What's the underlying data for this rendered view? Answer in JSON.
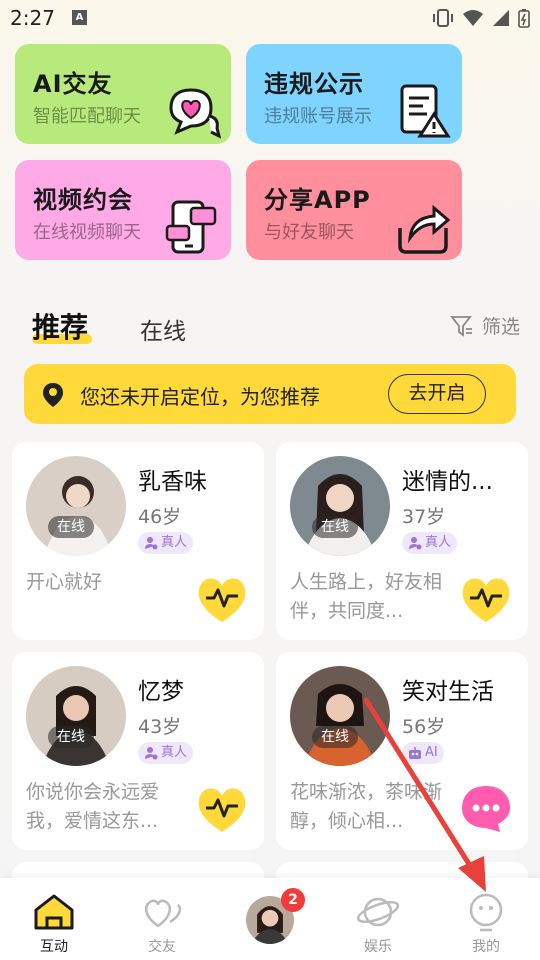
{
  "status_bar": {
    "time": "2:27",
    "a_icon": "A"
  },
  "feature_cards": [
    {
      "title": "AI交友",
      "subtitle": "智能匹配聊天",
      "icon": "chat-heart-icon"
    },
    {
      "title": "违规公示",
      "subtitle": "违规账号展示",
      "icon": "warning-document-icon"
    },
    {
      "title": "视频约会",
      "subtitle": "在线视频聊天",
      "icon": "video-phone-icon"
    },
    {
      "title": "分享APP",
      "subtitle": "与好友聊天",
      "icon": "share-icon"
    }
  ],
  "tabs": {
    "recommend": "推荐",
    "online": "在线",
    "filter": "筛选"
  },
  "location_banner": {
    "text": "您还未开启定位，为您推荐",
    "button": "去开启"
  },
  "profiles": [
    {
      "name": "乳香味",
      "age": "46岁",
      "badge": "真人",
      "status": "在线",
      "bio": "开心就好",
      "action": "heartbeat"
    },
    {
      "name": "迷情的...",
      "age": "37岁",
      "badge": "真人",
      "status": "在线",
      "bio": "人生路上，好友相伴，共同度...",
      "action": "heartbeat"
    },
    {
      "name": "忆梦",
      "age": "43岁",
      "badge": "真人",
      "status": "在线",
      "bio": "你说你会永远爱我，爱情这东...",
      "action": "heartbeat"
    },
    {
      "name": "笑对生活",
      "age": "56岁",
      "badge": "AI",
      "status": "在线",
      "bio": "花味渐浓，茶味渐醇，倾心相...",
      "action": "chat"
    }
  ],
  "bottom_nav": {
    "items": [
      {
        "label": "互动",
        "icon": "home-icon",
        "active": true
      },
      {
        "label": "交友",
        "icon": "hearts-icon",
        "active": false
      },
      {
        "label": "",
        "icon": "avatar",
        "badge": "2"
      },
      {
        "label": "娱乐",
        "icon": "planet-icon",
        "active": false
      },
      {
        "label": "我的",
        "icon": "profile-icon",
        "active": false
      }
    ]
  },
  "colors": {
    "accent_yellow": "#ffd93a",
    "card_green": "#b7ea7a",
    "card_blue": "#7fd3ff",
    "card_pink": "#ffa9e7",
    "card_red": "#ff8f9c",
    "badge_purple": "#9a74d8",
    "annotation_red": "#e8403a"
  }
}
